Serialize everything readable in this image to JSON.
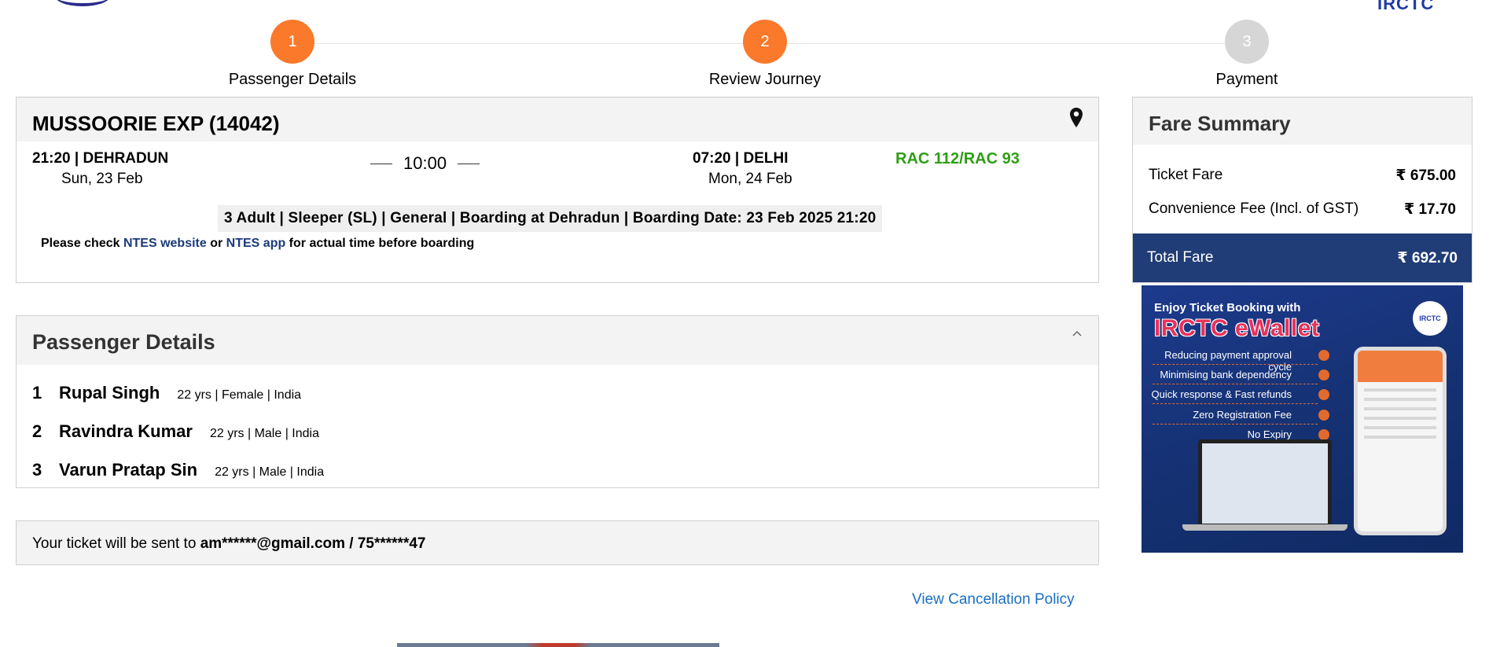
{
  "brand": {
    "top_right_logo": "IRCTC"
  },
  "stepper": [
    {
      "number": "1",
      "label": "Passenger Details",
      "state": "active"
    },
    {
      "number": "2",
      "label": "Review Journey",
      "state": "active"
    },
    {
      "number": "3",
      "label": "Payment",
      "state": "inactive"
    }
  ],
  "train": {
    "name": "MUSSOORIE EXP (14042)",
    "departure_time": "21:20 | DEHRADUN",
    "departure_date": "Sun, 23 Feb",
    "duration": "10:00",
    "arrival_time": "07:20 | DELHI",
    "arrival_date": "Mon, 24 Feb",
    "status": "RAC 112/RAC 93",
    "journey_info": "3 Adult | Sleeper (SL) | General | Boarding at Dehradun | Boarding Date: 23 Feb 2025 21:20",
    "ntes": {
      "prefix": "Please check ",
      "link1": "NTES website",
      "middle": " or ",
      "link2": "NTES app",
      "suffix": " for actual time before boarding"
    }
  },
  "passengers": {
    "title": "Passenger Details",
    "list": [
      {
        "no": "1",
        "name": "Rupal Singh",
        "meta": "22 yrs | Female | India"
      },
      {
        "no": "2",
        "name": "Ravindra Kumar",
        "meta": "22 yrs | Male | India"
      },
      {
        "no": "3",
        "name": "Varun Pratap Sin",
        "meta": "22 yrs | Male | India"
      }
    ]
  },
  "ticket_sent": {
    "prefix": "Your ticket will be sent to ",
    "contact": "am******@gmail.com / 75******47"
  },
  "cancellation_link": "View Cancellation Policy",
  "fare": {
    "title": "Fare Summary",
    "rows": [
      {
        "label": "Ticket Fare",
        "amount": "₹ 675.00"
      },
      {
        "label": "Convenience Fee (Incl. of GST)",
        "amount": "₹ 17.70"
      }
    ],
    "total_label": "Total Fare",
    "total_amount": "₹ 692.70"
  },
  "ad": {
    "line1": "Enjoy Ticket Booking with",
    "line2": "IRCTC eWallet",
    "logo_text": "IRCTC",
    "features": [
      "Reducing payment approval cycle",
      "Minimising bank dependency",
      "Quick response & Fast refunds",
      "Zero Registration Fee",
      "No Expiry"
    ]
  },
  "colors": {
    "step_active": "#fb792b",
    "step_inactive": "#d6d6d6",
    "status_green": "#2e9e14",
    "total_bar": "#213d77",
    "link_blue": "#1a6fc4"
  }
}
